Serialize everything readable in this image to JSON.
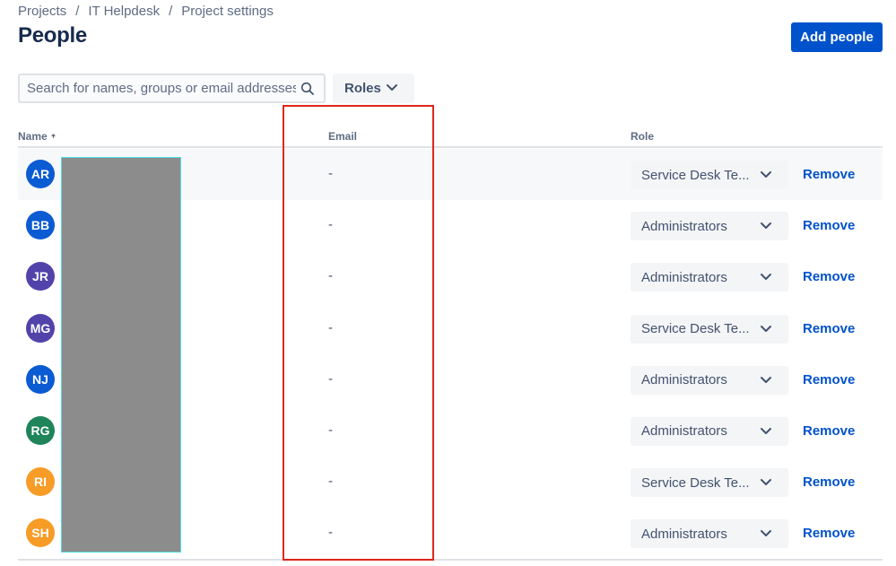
{
  "breadcrumb": [
    "Projects",
    "IT Helpdesk",
    "Project settings"
  ],
  "page_title": "People",
  "add_button": "Add people",
  "search": {
    "placeholder": "Search for names, groups or email addresses"
  },
  "roles_filter": "Roles",
  "table_headers": {
    "name": "Name",
    "email": "Email",
    "role": "Role"
  },
  "rows": [
    {
      "initials": "AR",
      "color": "#0b5bd3",
      "email": "-",
      "role": "Service Desk Te...",
      "action": "Remove"
    },
    {
      "initials": "BB",
      "color": "#0b5bd3",
      "email": "-",
      "role": "Administrators",
      "action": "Remove"
    },
    {
      "initials": "JR",
      "color": "#5243aa",
      "email": "-",
      "role": "Administrators",
      "action": "Remove"
    },
    {
      "initials": "MG",
      "color": "#5243aa",
      "email": "-",
      "role": "Service Desk Te...",
      "action": "Remove"
    },
    {
      "initials": "NJ",
      "color": "#0b5bd3",
      "email": "-",
      "role": "Administrators",
      "action": "Remove"
    },
    {
      "initials": "RG",
      "color": "#1f845a",
      "email": "-",
      "role": "Administrators",
      "action": "Remove"
    },
    {
      "initials": "RI",
      "color": "#f79c27",
      "email": "-",
      "role": "Service Desk Te...",
      "action": "Remove"
    },
    {
      "initials": "SH",
      "color": "#f79c27",
      "email": "-",
      "role": "Administrators",
      "action": "Remove"
    }
  ],
  "colors": {
    "accent": "#0052cc",
    "highlight": "#e0261c",
    "redaction": "#8c8c8c"
  },
  "icons": {
    "search": "search-icon",
    "chevron": "chevron-down-icon",
    "sort": "sort-ascending-icon"
  }
}
